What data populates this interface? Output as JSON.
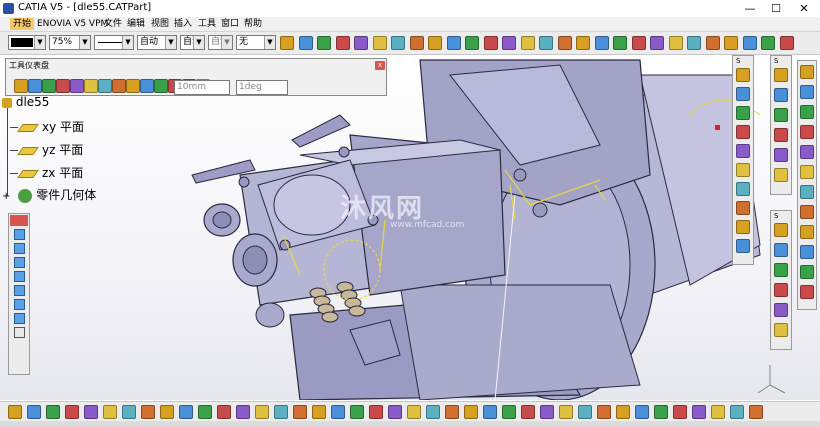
{
  "window": {
    "title": "CATIA V5 - [dle55.CATPart]",
    "minimize": "—",
    "maximize": "☐",
    "close": "✕"
  },
  "menu": [
    "开始",
    "ENOVIA V5 VPM",
    "文件",
    "编辑",
    "视图",
    "插入",
    "工具",
    "窗口",
    "帮助"
  ],
  "toolbar": {
    "zoom": "75%",
    "style_auto": "自动",
    "font_auto": "自动",
    "none": "无"
  },
  "floating_toolbar": {
    "title": "工具仪表盘",
    "close": "x",
    "length": "10mm",
    "angle": "1deg"
  },
  "tree": {
    "root": "dle55",
    "items": [
      "xy 平面",
      "yz 平面",
      "zx 平面",
      "零件几何体"
    ]
  },
  "watermark": {
    "text": "沐风网",
    "url": "www.mfcad.com"
  },
  "small_panel_label": "S",
  "colors": {
    "model": "#a6a6c9",
    "highlight": "#e8d640",
    "accent_title": "#2a4fa3"
  }
}
